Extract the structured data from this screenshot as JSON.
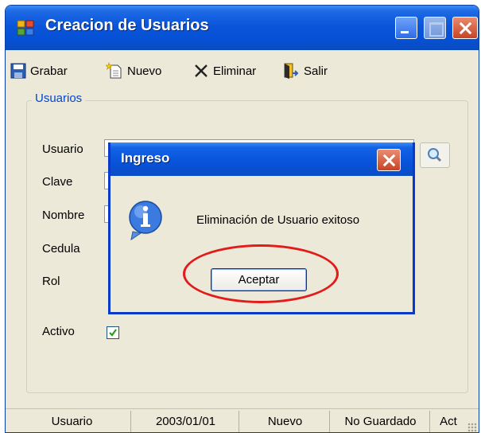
{
  "window": {
    "title": "Creacion de Usuarios"
  },
  "toolbar": {
    "save_label": "Grabar",
    "new_label": "Nuevo",
    "delete_label": "Eliminar",
    "exit_label": "Salir"
  },
  "group": {
    "title": "Usuarios"
  },
  "fields": {
    "usuario": "Usuario",
    "clave": "Clave",
    "nombre": "Nombre",
    "cedula": "Cedula",
    "rol": "Rol",
    "activo": "Activo"
  },
  "statusbar": {
    "user": "Usuario",
    "date": "2003/01/01",
    "mode": "Nuevo",
    "save_state": "No Guardado",
    "extra": "Act"
  },
  "dialog": {
    "title": "Ingreso",
    "message": "Eliminación de Usuario exitoso",
    "ok_label": "Aceptar"
  },
  "colors": {
    "title_blue": "#0a55d9",
    "group_title": "#0046d5",
    "highlight": "#e21b1b"
  }
}
